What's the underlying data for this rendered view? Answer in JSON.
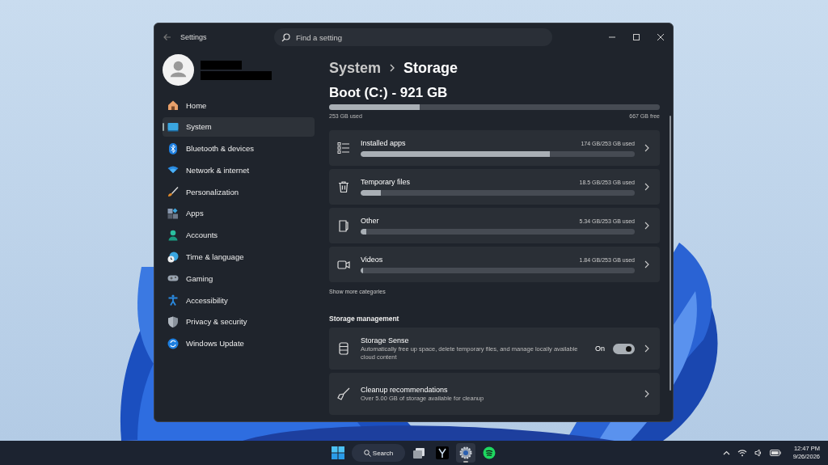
{
  "window": {
    "title": "Settings",
    "search": {
      "placeholder": "Find a setting"
    }
  },
  "sidebar": {
    "items": [
      {
        "kind": "home",
        "label": "Home",
        "selected": false
      },
      {
        "kind": "system",
        "label": "System",
        "selected": true
      },
      {
        "kind": "bluetooth",
        "label": "Bluetooth & devices",
        "selected": false
      },
      {
        "kind": "network",
        "label": "Network & internet",
        "selected": false
      },
      {
        "kind": "brush",
        "label": "Personalization",
        "selected": false
      },
      {
        "kind": "apps",
        "label": "Apps",
        "selected": false
      },
      {
        "kind": "accounts",
        "label": "Accounts",
        "selected": false
      },
      {
        "kind": "time",
        "label": "Time & language",
        "selected": false
      },
      {
        "kind": "gaming",
        "label": "Gaming",
        "selected": false
      },
      {
        "kind": "accessibility",
        "label": "Accessibility",
        "selected": false
      },
      {
        "kind": "privacy",
        "label": "Privacy & security",
        "selected": false
      },
      {
        "kind": "update",
        "label": "Windows Update",
        "selected": false
      }
    ]
  },
  "breadcrumb": {
    "parent": "System",
    "current": "Storage"
  },
  "drive": {
    "title": "Boot (C:) - 921 GB",
    "level": 0.275,
    "used": "253 GB used",
    "free": "667 GB free"
  },
  "categories": [
    {
      "kind": "apps",
      "label": "Installed apps",
      "reading": "174 GB/253 GB used",
      "level": 0.69
    },
    {
      "kind": "temp",
      "label": "Temporary files",
      "reading": "18.5 GB/253 GB used",
      "level": 0.073
    },
    {
      "kind": "other",
      "label": "Other",
      "reading": "5.34 GB/253 GB used",
      "level": 0.02
    },
    {
      "kind": "videos",
      "label": "Videos",
      "reading": "1.84 GB/253 GB used",
      "level": 0.008
    }
  ],
  "show_more": "Show more categories",
  "management": {
    "heading": "Storage management",
    "items": [
      {
        "kind": "sense",
        "title": "Storage Sense",
        "description": "Automatically free up space, delete temporary files, and manage locally available cloud content",
        "toggle": {
          "label": "On",
          "on": true
        }
      },
      {
        "kind": "cleanup",
        "title": "Cleanup recommendations",
        "description": "Over 5.00 GB of storage available for cleanup"
      }
    ]
  },
  "taskbar": {
    "search": "Search",
    "apps": [
      {
        "kind": "taskview",
        "selected": false
      },
      {
        "kind": "ylogo",
        "selected": false
      },
      {
        "kind": "settings",
        "selected": true
      },
      {
        "kind": "music",
        "selected": false
      }
    ],
    "clock": {
      "time": "12:47 PM",
      "date": "9/26/2026"
    }
  }
}
